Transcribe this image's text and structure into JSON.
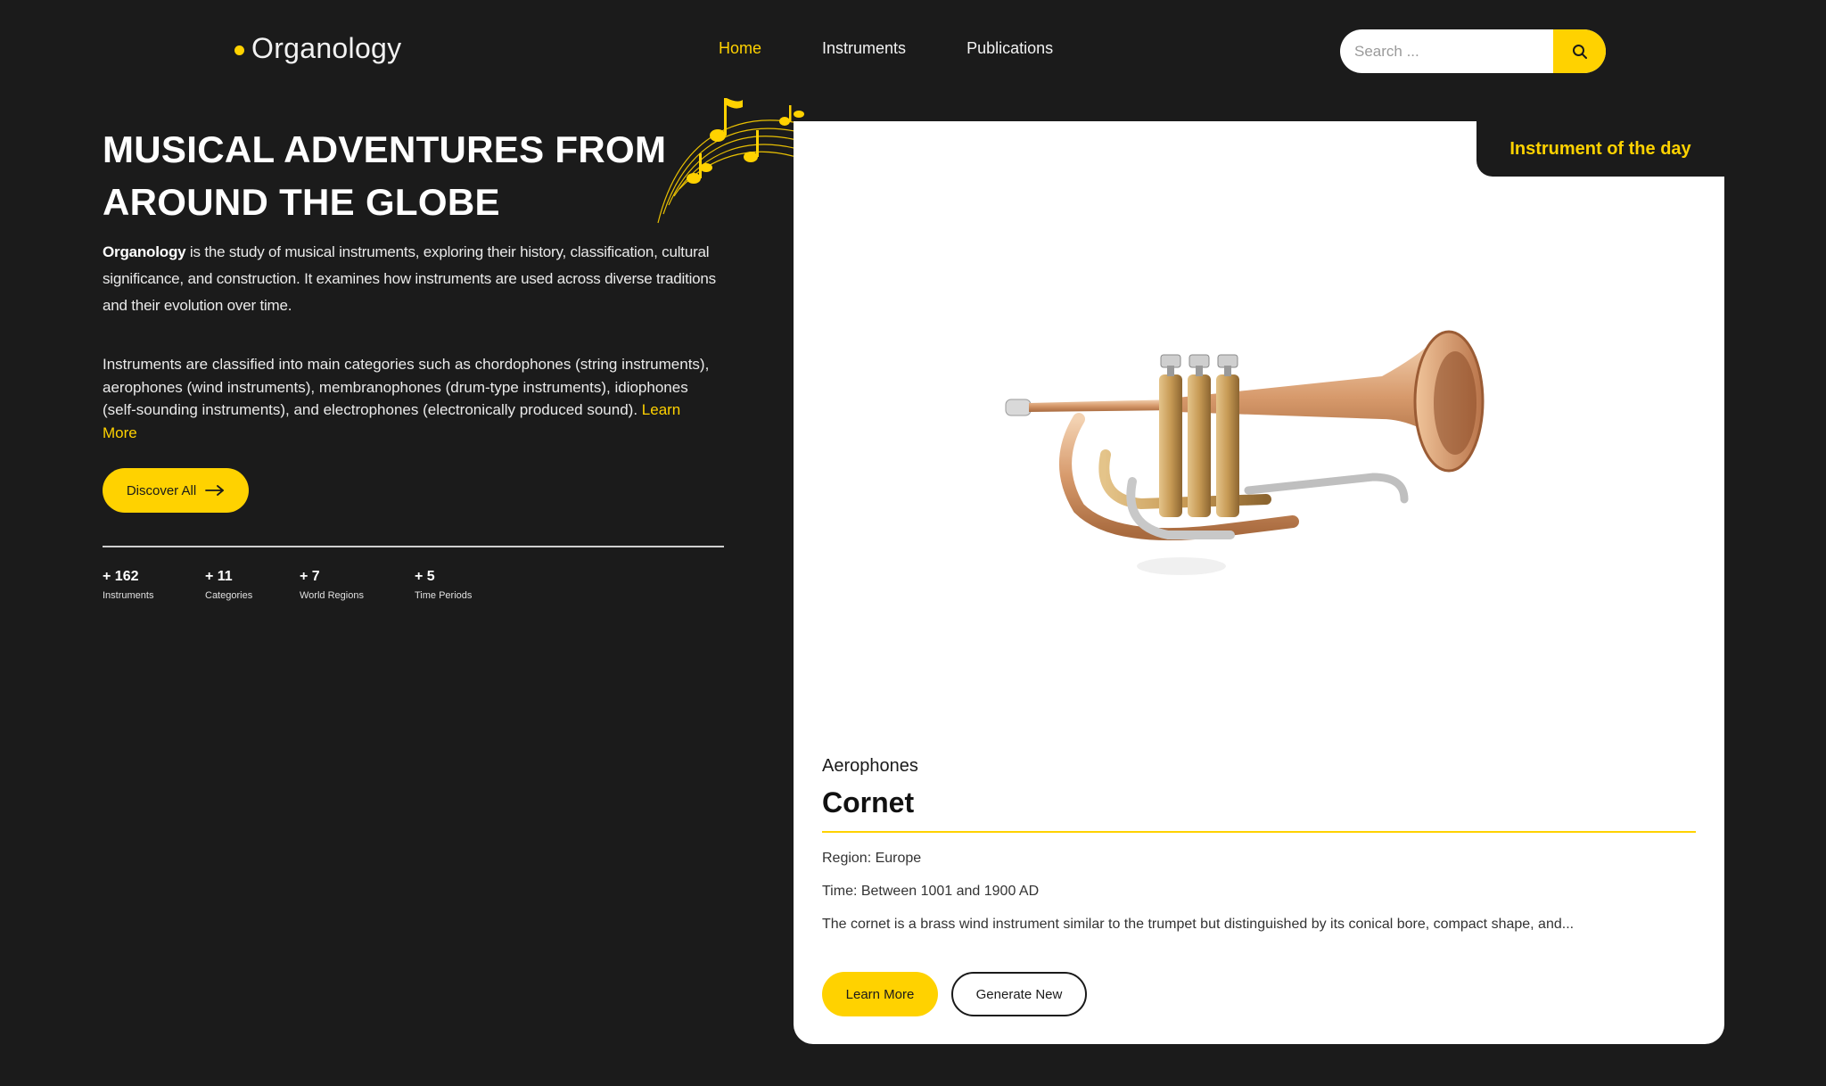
{
  "brand": {
    "name": "Organology"
  },
  "nav": {
    "items": [
      {
        "label": "Home",
        "active": true
      },
      {
        "label": "Instruments",
        "active": false
      },
      {
        "label": "Publications",
        "active": false
      }
    ]
  },
  "search": {
    "placeholder": "Search ...",
    "icon": "search-icon"
  },
  "hero": {
    "title_line1": "MUSICAL ADVENTURES FROM",
    "title_line2": "AROUND THE GLOBE",
    "intro_bold": "Organology",
    "intro_rest": " is the study of musical instruments, exploring their history, classification, cultural significance, and construction. It examines how instruments are used across diverse traditions and their evolution over time.",
    "classes_text": "Instruments are classified into main categories such as chordophones (string instruments), aerophones (wind instruments), membranophones (drum-type instruments), idiophones (self-sounding instruments), and electrophones (electronically produced sound). ",
    "learn_more": "Learn More",
    "discover_label": "Discover All"
  },
  "stats": [
    {
      "value": "+ 162",
      "label": "Instruments"
    },
    {
      "value": "+ 11",
      "label": "Categories"
    },
    {
      "value": "+ 7",
      "label": "World Regions"
    },
    {
      "value": "+ 5",
      "label": "Time Periods"
    }
  ],
  "featured": {
    "tab_label": "Instrument of the day",
    "category": "Aerophones",
    "name": "Cornet",
    "region": "Region: Europe",
    "time": "Time: Between 1001 and 1900 AD",
    "description": "The cornet is a brass wind instrument similar to the trumpet but distinguished by its conical bore, compact shape, and...",
    "learn_more_label": "Learn More",
    "generate_label": "Generate New"
  },
  "colors": {
    "accent": "#ffd200",
    "background": "#1b1b1b",
    "card": "#ffffff"
  }
}
